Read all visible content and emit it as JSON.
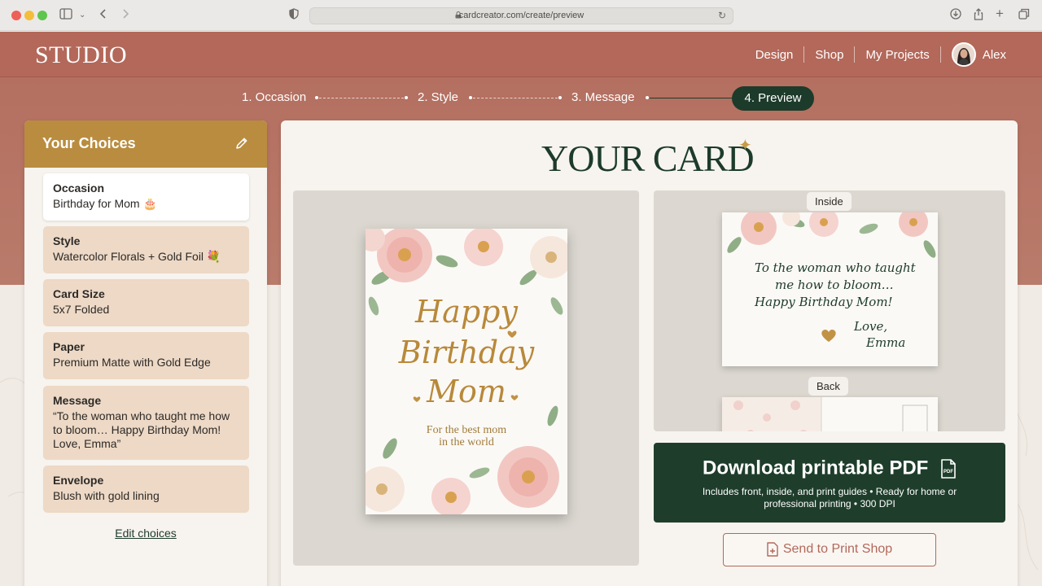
{
  "browser": {
    "url": "cardcreator.com/create/preview"
  },
  "header": {
    "logo": "STUDIO",
    "nav": [
      "Design",
      "Shop",
      "My Projects"
    ],
    "user_name": "Alex"
  },
  "stepper": {
    "steps": [
      "1. Occasion",
      "2. Style",
      "3. Message",
      "4. Preview"
    ],
    "active_index": 3
  },
  "sidebar": {
    "title": "Your Choices",
    "choices": [
      {
        "label": "Occasion",
        "value": "Birthday for Mom 🎂"
      },
      {
        "label": "Style",
        "value": "Watercolor Florals + Gold Foil 💐"
      },
      {
        "label": "Card Size",
        "value": "5x7 Folded"
      },
      {
        "label": "Paper",
        "value": "Premium Matte with Gold Edge"
      },
      {
        "label": "Message",
        "value": "“To the woman who taught me how to bloom… Happy Birthday Mom! Love, Emma”"
      },
      {
        "label": "Envelope",
        "value": "Blush with gold lining"
      }
    ],
    "edit_link": "Edit choices"
  },
  "preview": {
    "title": "YOUR CARD",
    "front": {
      "lines": [
        "Happy",
        "Birthday",
        "Mom"
      ],
      "subtitle_lines": [
        "For the best mom",
        "in the world"
      ]
    },
    "inside_tag": "Inside",
    "inside_message_lines": [
      "To the woman who taught",
      "me how to bloom…",
      "Happy Birthday Mom!"
    ],
    "inside_sign_lines": [
      "Love,",
      "Emma"
    ],
    "back_tag": "Back"
  },
  "actions": {
    "pdf_title": "Download printable PDF",
    "pdf_subtitle": "Includes front, inside, and print guides • Ready for home or professional printing • 300 DPI",
    "print_label": "Send to Print Shop"
  },
  "colors": {
    "header": "#b3685a",
    "sidebar_header": "#b98c3f",
    "dark_green": "#1d3b2a",
    "choice_bg": "#edd9c6",
    "gold": "#b8893a"
  },
  "icons": {
    "edit": "pencil-icon",
    "pdf": "file-pdf-icon",
    "print": "file-plus-icon",
    "sparkle": "sparkle-icon"
  }
}
